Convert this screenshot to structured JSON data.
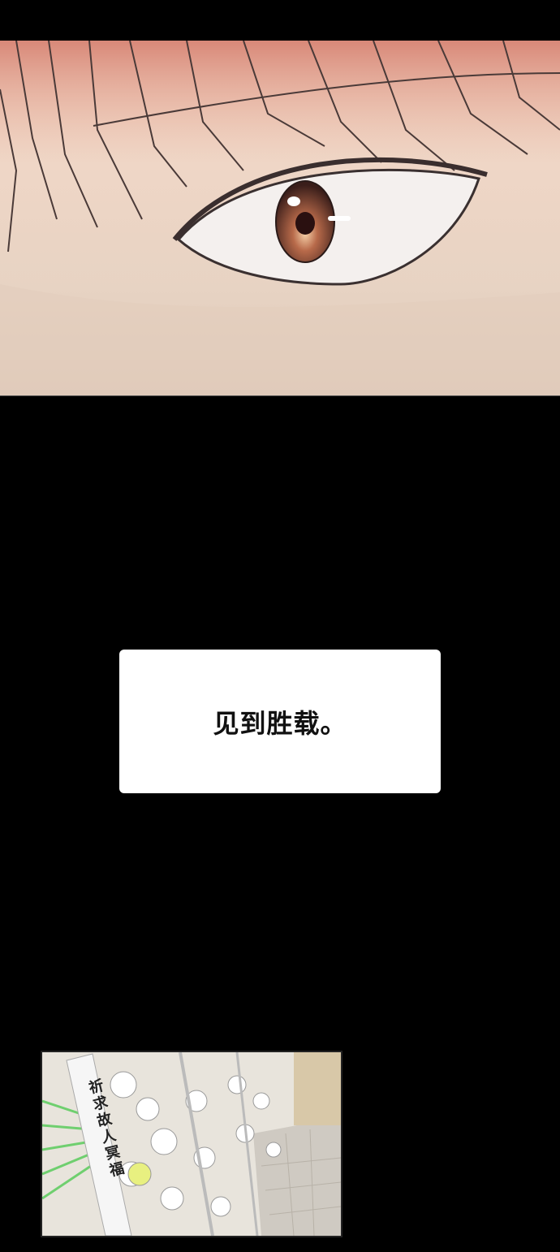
{
  "panels": {
    "eye_panel": {
      "subject": "eye-closeup"
    },
    "caption": {
      "text": "见到胜载。"
    },
    "flowers_panel": {
      "banner_text": "祈求故人冥福"
    }
  },
  "colors": {
    "background": "#000000",
    "skin": "#efd6c6",
    "hair": "#e0a090",
    "iris": "#4a2a22",
    "caption_bg": "#ffffff"
  }
}
